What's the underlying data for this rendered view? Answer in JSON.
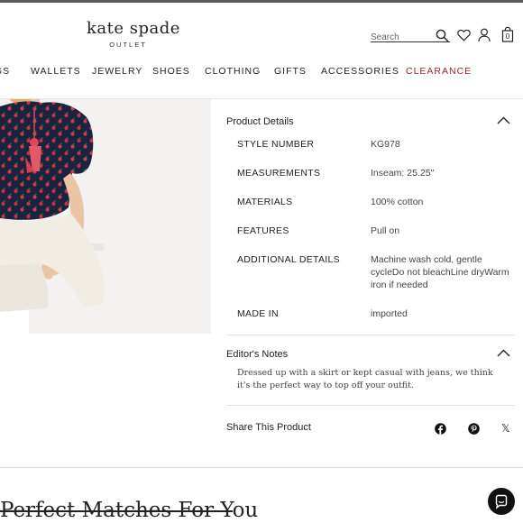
{
  "brand": {
    "name": "kate spade",
    "sub": "OUTLET"
  },
  "search": {
    "placeholder": "Search"
  },
  "icons": {
    "search": "search-icon",
    "wishlist": "heart-icon",
    "account": "user-icon",
    "bag": "shopping-bag-icon",
    "chevron": "chevron-up-icon",
    "chat": "chat-icon"
  },
  "bag": {
    "count": "0"
  },
  "nav": [
    {
      "label": "GS"
    },
    {
      "label": "WALLETS"
    },
    {
      "label": "JEWELRY"
    },
    {
      "label": "SHOES"
    },
    {
      "label": "CLOTHING"
    },
    {
      "label": "GIFTS"
    },
    {
      "label": "ACCESSORIES"
    },
    {
      "label": "CLEARANCE"
    }
  ],
  "colors": {
    "clearance": "#a0252b",
    "top_navy": "#1c2340",
    "tomato_red": "#c8323a"
  },
  "product_details": {
    "title": "Product Details",
    "specs": [
      {
        "label": "STYLE NUMBER",
        "value": "KG978"
      },
      {
        "label": "MEASUREMENTS",
        "value": "Inseam: 25.25\""
      },
      {
        "label": "MATERIALS",
        "value": "100% cotton"
      },
      {
        "label": "FEATURES",
        "value": "Pull on"
      },
      {
        "label": "ADDITIONAL DETAILS",
        "value": "Machine wash cold, gentle cycleDo not bleachLine dryWarm iron if needed"
      },
      {
        "label": "MADE IN",
        "value": "imported"
      }
    ]
  },
  "editors_notes": {
    "title": "Editor's Notes",
    "text": "Dressed up with a skirt or kept casual with jeans, we think it's the perfect way to top off your outfit."
  },
  "share": {
    "label": "Share This Product",
    "networks": [
      "facebook-icon",
      "pinterest-icon",
      "x-icon"
    ],
    "x_glyph": "𝕏"
  },
  "matches": {
    "title": "Perfect Matches For You"
  }
}
